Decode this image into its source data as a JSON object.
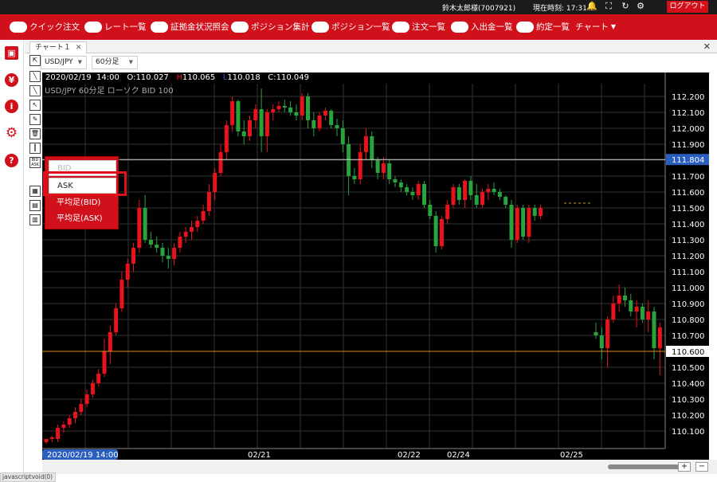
{
  "topbar": {
    "user": "鈴木太郎様(7007921)",
    "clock_label": "現在時刻: 17:31",
    "icons": [
      "bell-icon",
      "fullscreen-icon",
      "refresh-icon",
      "gear-icon"
    ],
    "logout_label": "ログアウト"
  },
  "menu": {
    "items": [
      {
        "label": "クイック注文"
      },
      {
        "label": "レート一覧"
      },
      {
        "label": "証拠金状況照会"
      },
      {
        "label": "ポジション集計"
      },
      {
        "label": "ポジション一覧"
      },
      {
        "label": "注文一覧"
      },
      {
        "label": "入出金一覧"
      },
      {
        "label": "約定一覧"
      }
    ],
    "chart_menu_label": "チャート"
  },
  "sidebar": {
    "icons": [
      "save-icon",
      "yen-icon",
      "info-icon",
      "settings-icon",
      "help-icon"
    ]
  },
  "tab": {
    "label": "チャート１",
    "close": "✕"
  },
  "window_close": "✕",
  "toolbar": {
    "pair": "USD/JPY",
    "timeframe": "60分足"
  },
  "chart_info": {
    "line1_date": "2020/02/19",
    "line1_time": "14:00",
    "open": "O:110.027",
    "high_marker": "H",
    "high": "110.065",
    "low_marker": "L",
    "low": "110.018",
    "close": "C:110.049",
    "line2": "USD/JPY  60分足  ローソク  BID  100"
  },
  "popup": {
    "bid": "BID",
    "ask": "ASK",
    "avg_bid": "平均足(BID)",
    "avg_ask": "平均足(ASK)"
  },
  "bottom": {
    "cursor_label": "2020/02/19 14:00",
    "zoom_in": "+",
    "zoom_out": "−"
  },
  "statusbar": "javascriptvoid(0)",
  "colors": {
    "brand_red": "#d0101a",
    "candle_up": "#e8141c",
    "candle_down": "#29a33c",
    "price_line": "#2b5fbf",
    "orange_line": "#e08a1a"
  },
  "chart_data": {
    "type": "candlestick",
    "y_ticks": [
      "112.200",
      "112.100",
      "112.000",
      "111.900",
      "111.800",
      "111.700",
      "111.600",
      "111.500",
      "111.400",
      "111.300",
      "111.200",
      "111.100",
      "111.000",
      "110.900",
      "110.800",
      "110.700",
      "110.600",
      "110.500",
      "110.400",
      "110.300",
      "110.200",
      "110.100"
    ],
    "x_labels": [
      "02/21",
      "02/22",
      "02/24",
      "02/25"
    ],
    "current_price_label": "111.804",
    "current_price": 111.804,
    "orange_level_label": "110.600",
    "orange_level": 110.6,
    "ylim": [
      110.0,
      112.3
    ],
    "candles": [
      [
        110.03,
        110.05,
        110.02,
        110.05
      ],
      [
        110.05,
        110.07,
        110.03,
        110.06
      ],
      [
        110.05,
        110.14,
        110.03,
        110.12
      ],
      [
        110.12,
        110.16,
        110.09,
        110.14
      ],
      [
        110.14,
        110.2,
        110.12,
        110.18
      ],
      [
        110.18,
        110.25,
        110.15,
        110.22
      ],
      [
        110.22,
        110.3,
        110.2,
        110.27
      ],
      [
        110.27,
        110.36,
        110.25,
        110.33
      ],
      [
        110.33,
        110.42,
        110.31,
        110.4
      ],
      [
        110.4,
        110.49,
        110.38,
        110.46
      ],
      [
        110.46,
        110.68,
        110.44,
        110.6
      ],
      [
        110.6,
        110.76,
        110.52,
        110.72
      ],
      [
        110.72,
        110.9,
        110.7,
        110.87
      ],
      [
        110.87,
        111.1,
        110.85,
        111.05
      ],
      [
        111.05,
        111.18,
        111.0,
        111.15
      ],
      [
        111.15,
        111.28,
        111.1,
        111.25
      ],
      [
        111.25,
        111.55,
        111.22,
        111.5
      ],
      [
        111.5,
        111.58,
        111.28,
        111.3
      ],
      [
        111.3,
        111.35,
        111.25,
        111.27
      ],
      [
        111.27,
        111.32,
        111.22,
        111.25
      ],
      [
        111.25,
        111.28,
        111.16,
        111.2
      ],
      [
        111.2,
        111.25,
        111.12,
        111.18
      ],
      [
        111.18,
        111.28,
        111.14,
        111.25
      ],
      [
        111.25,
        111.35,
        111.22,
        111.32
      ],
      [
        111.32,
        111.38,
        111.28,
        111.35
      ],
      [
        111.35,
        111.42,
        111.3,
        111.38
      ],
      [
        111.38,
        111.45,
        111.35,
        111.42
      ],
      [
        111.42,
        111.52,
        111.4,
        111.48
      ],
      [
        111.48,
        111.65,
        111.45,
        111.6
      ],
      [
        111.6,
        111.75,
        111.55,
        111.72
      ],
      [
        111.72,
        111.9,
        111.7,
        111.85
      ],
      [
        111.85,
        112.05,
        111.8,
        112.02
      ],
      [
        112.02,
        112.2,
        111.98,
        112.17
      ],
      [
        112.17,
        112.18,
        111.95,
        111.98
      ],
      [
        111.98,
        112.05,
        111.9,
        111.95
      ],
      [
        111.95,
        112.08,
        111.92,
        112.05
      ],
      [
        112.05,
        112.15,
        112.0,
        112.12
      ],
      [
        112.12,
        112.25,
        111.85,
        111.95
      ],
      [
        111.95,
        112.12,
        111.85,
        112.1
      ],
      [
        112.1,
        112.15,
        112.05,
        112.12
      ],
      [
        112.12,
        112.17,
        112.1,
        112.14
      ],
      [
        112.14,
        112.18,
        112.1,
        112.13
      ],
      [
        112.13,
        112.17,
        112.08,
        112.1
      ],
      [
        112.1,
        112.15,
        112.05,
        112.08
      ],
      [
        112.08,
        112.22,
        112.05,
        112.2
      ],
      [
        112.2,
        112.22,
        112.0,
        112.05
      ],
      [
        112.05,
        112.1,
        111.95,
        112.0
      ],
      [
        112.0,
        112.1,
        111.98,
        112.08
      ],
      [
        112.08,
        112.13,
        112.05,
        112.11
      ],
      [
        112.11,
        112.12,
        112.0,
        112.02
      ],
      [
        112.02,
        112.06,
        111.95,
        112.0
      ],
      [
        112.0,
        112.05,
        111.85,
        111.9
      ],
      [
        111.9,
        111.95,
        111.58,
        111.7
      ],
      [
        111.7,
        111.75,
        111.65,
        111.68
      ],
      [
        111.68,
        111.9,
        111.65,
        111.85
      ],
      [
        111.85,
        112.0,
        111.8,
        111.95
      ],
      [
        111.95,
        111.98,
        111.75,
        111.8
      ],
      [
        111.8,
        111.82,
        111.68,
        111.72
      ],
      [
        111.72,
        111.82,
        111.68,
        111.78
      ],
      [
        111.78,
        111.8,
        111.65,
        111.68
      ],
      [
        111.68,
        111.7,
        111.63,
        111.66
      ],
      [
        111.66,
        111.68,
        111.6,
        111.63
      ],
      [
        111.63,
        111.65,
        111.58,
        111.6
      ],
      [
        111.6,
        111.63,
        111.55,
        111.58
      ],
      [
        111.58,
        111.67,
        111.55,
        111.65
      ],
      [
        111.65,
        111.67,
        111.5,
        111.52
      ],
      [
        111.52,
        111.55,
        111.43,
        111.45
      ],
      [
        111.45,
        111.48,
        111.22,
        111.26
      ],
      [
        111.26,
        111.45,
        111.24,
        111.43
      ],
      [
        111.43,
        111.55,
        111.4,
        111.52
      ],
      [
        111.52,
        111.65,
        111.5,
        111.63
      ],
      [
        111.63,
        111.65,
        111.52,
        111.55
      ],
      [
        111.55,
        111.68,
        111.5,
        111.67
      ],
      [
        111.67,
        111.7,
        111.55,
        111.58
      ],
      [
        111.58,
        111.65,
        111.5,
        111.52
      ],
      [
        111.52,
        111.62,
        111.5,
        111.6
      ],
      [
        111.6,
        111.65,
        111.55,
        111.62
      ],
      [
        111.62,
        111.66,
        111.58,
        111.6
      ],
      [
        111.6,
        111.62,
        111.55,
        111.57
      ],
      [
        111.57,
        111.58,
        111.5,
        111.52
      ],
      [
        111.52,
        111.55,
        111.25,
        111.3
      ],
      [
        111.3,
        111.52,
        111.28,
        111.5
      ],
      [
        111.5,
        111.52,
        111.3,
        111.32
      ],
      [
        111.32,
        111.52,
        111.28,
        111.5
      ],
      [
        111.5,
        111.52,
        111.42,
        111.45
      ],
      [
        111.45,
        111.52,
        111.43,
        111.5
      ],
      [
        110.72,
        110.78,
        110.68,
        110.7
      ],
      [
        110.7,
        110.75,
        110.55,
        110.62
      ],
      [
        110.62,
        110.82,
        110.5,
        110.8
      ],
      [
        110.8,
        110.95,
        110.78,
        110.9
      ],
      [
        110.9,
        111.02,
        110.85,
        110.95
      ],
      [
        110.95,
        111.0,
        110.88,
        110.92
      ],
      [
        110.92,
        110.96,
        110.82,
        110.85
      ],
      [
        110.85,
        110.92,
        110.75,
        110.88
      ],
      [
        110.88,
        110.9,
        110.78,
        110.8
      ],
      [
        110.8,
        110.92,
        110.72,
        110.85
      ],
      [
        110.85,
        110.88,
        110.55,
        110.62
      ],
      [
        110.62,
        110.78,
        110.45,
        110.75
      ]
    ]
  }
}
